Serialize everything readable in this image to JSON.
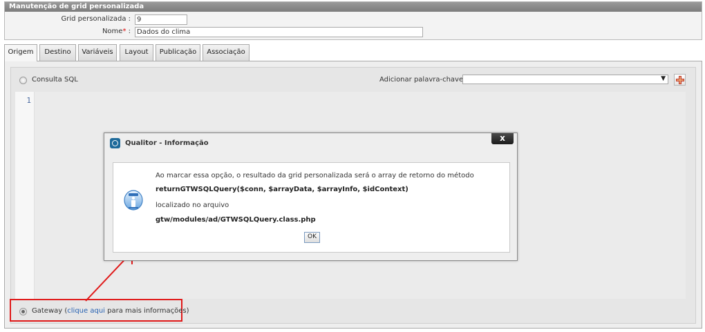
{
  "header": {
    "title": "Manutenção de grid personalizada",
    "grid_label": "Grid personalizada :",
    "grid_value": "9",
    "name_label": "Nome",
    "name_required": "*",
    "name_colon": ":",
    "name_value": "Dados do clima"
  },
  "tabs": [
    {
      "label": "Origem",
      "active": true
    },
    {
      "label": "Destino"
    },
    {
      "label": "Variáveis"
    },
    {
      "label": "Layout"
    },
    {
      "label": "Publicação"
    },
    {
      "label": "Associação"
    }
  ],
  "origin": {
    "sql_option_label": "Consulta SQL",
    "keyword_label": "Adicionar palavra-chave :",
    "keyword_value": "",
    "line_number": "1",
    "gateway_label": "Gateway (",
    "gateway_link": "clique aqui",
    "gateway_suffix": " para mais informações)",
    "gateway_selected": true
  },
  "dialog": {
    "title": "Qualitor - Informação",
    "close_label": "x",
    "line1": "Ao marcar essa opção, o resultado da grid personalizada será o array de retorno do método",
    "line2": "returnGTWSQLQuery($conn, $arrayData, $arrayInfo, $idContext)",
    "line3": "localizado no arquivo",
    "line4": "gtw/modules/ad/GTWSQLQuery.class.php",
    "ok_label": "OK"
  },
  "colors": {
    "highlight_box": "#e01919",
    "link": "#2762b2",
    "title_bar": "#8a8a8a"
  }
}
